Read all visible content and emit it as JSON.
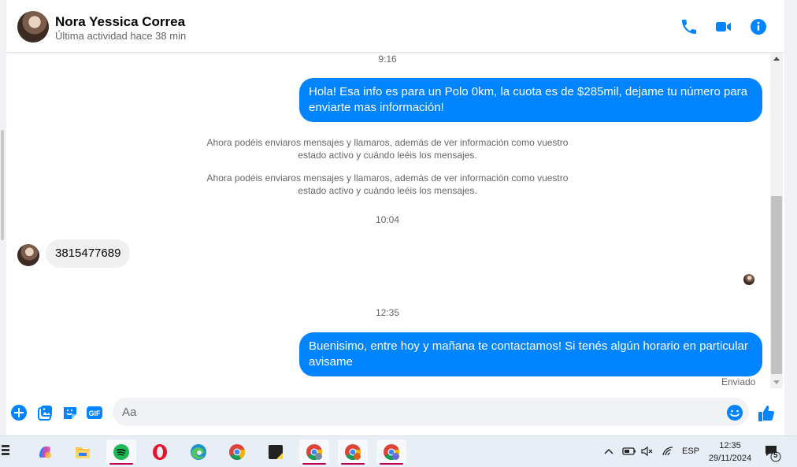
{
  "contact": {
    "name": "Nora Yessica Correa",
    "last_active": "Última actividad hace 38 min"
  },
  "header_icons": [
    "phone-icon",
    "video-icon",
    "info-icon"
  ],
  "messages": {
    "time_1": "9:16",
    "out_1": "Hola! Esa info es para un Polo 0km, la cuota es de $285mil, dejame tu número para enviarte mas información!",
    "system_1": "Ahora podéis enviaros mensajes y llamaros, además de ver información como vuestro estado activo y cuándo leéis los mensajes.",
    "system_2": "Ahora podéis enviaros mensajes y llamaros, además de ver información como vuestro estado activo y cuándo leéis los mensajes.",
    "time_2": "10:04",
    "in_1": "3815477689",
    "time_3": "12:35",
    "out_2": "Buenisimo, entre hoy y mañana te contactamos! Si tenés algún horario en particular avisame",
    "status": "Enviado"
  },
  "composer": {
    "placeholder": "Aa",
    "icons": [
      "plus-icon",
      "image-icon",
      "sticker-icon",
      "gif-icon",
      "emoji-icon",
      "like-icon"
    ],
    "gif_label": "GIF"
  },
  "taskbar": {
    "apps": [
      "copilot",
      "file-explorer",
      "spotify",
      "opera",
      "edge",
      "chrome",
      "sticky-notes",
      "chrome-profile-y",
      "chrome-profile-r",
      "chrome-profile-c"
    ],
    "language": "ESP",
    "time": "12:35",
    "date": "29/11/2024",
    "notification_count": "5"
  },
  "colors": {
    "messenger_blue": "#0084ff",
    "bubble_gray": "#f0f0f0",
    "taskbar_bg": "#e8eef6"
  }
}
